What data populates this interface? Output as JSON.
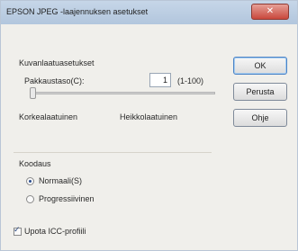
{
  "window": {
    "title": "EPSON JPEG -laajennuksen asetukset",
    "close_glyph": "✕"
  },
  "buttons": {
    "ok_label": "OK",
    "reset_label": "Perusta",
    "help_label": "Ohje"
  },
  "compression": {
    "section_label": "Kuvanlaatuasetukset",
    "rate_label": "Pakkaustaso(C):",
    "rate_value": "1",
    "rate_range_label": "(1-100)",
    "slider_value_fraction": 0.0,
    "low_label": "Korkealaatuinen",
    "high_label": "Heikkolaatuinen"
  },
  "encoding": {
    "section_label": "Koodaus",
    "options": [
      {
        "label": "Normaali(S)",
        "checked": true
      },
      {
        "label": "Progressiivinen",
        "checked": false
      }
    ]
  },
  "icc": {
    "label": "Upota ICC-profiili",
    "checked": true
  }
}
